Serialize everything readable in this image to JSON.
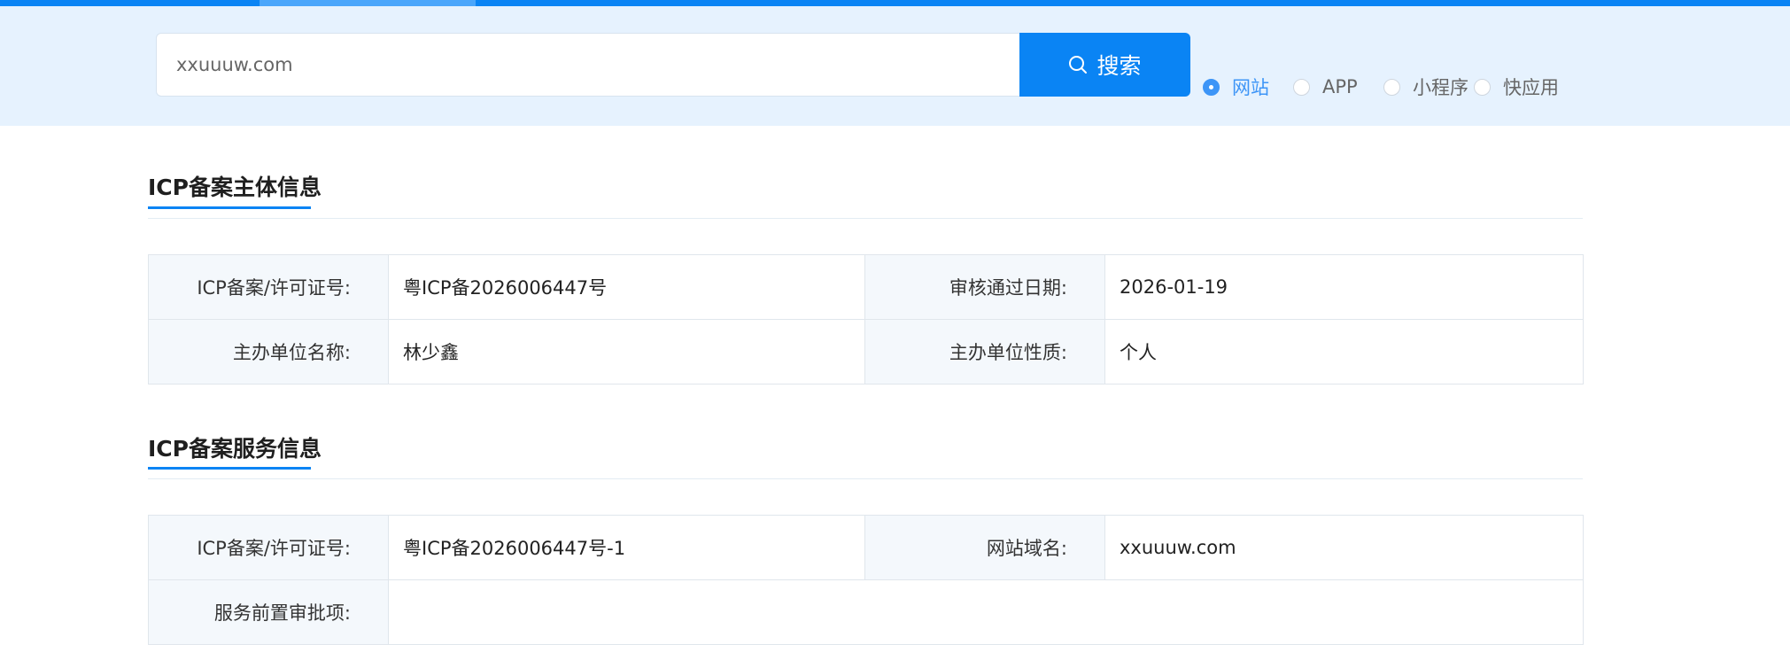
{
  "search": {
    "value": "xxuuuw.com",
    "button_label": "搜索",
    "button_icon": "search-icon",
    "accent_color": "#0a84f4"
  },
  "radio_options": [
    {
      "label": "网站",
      "selected": true
    },
    {
      "label": "APP",
      "selected": false
    },
    {
      "label": "小程序",
      "selected": false
    },
    {
      "label": "快应用",
      "selected": false
    }
  ],
  "subject_section": {
    "title": "ICP备案主体信息",
    "rows": [
      {
        "label1": "ICP备案/许可证号:",
        "value1": "粤ICP备2026006447号",
        "label2": "审核通过日期:",
        "value2": "2026-01-19"
      },
      {
        "label1": "主办单位名称:",
        "value1": "林少鑫",
        "label2": "主办单位性质:",
        "value2": "个人"
      }
    ]
  },
  "service_section": {
    "title": "ICP备案服务信息",
    "rows": [
      {
        "label1": "ICP备案/许可证号:",
        "value1": "粤ICP备2026006447号-1",
        "label2": "网站域名:",
        "value2": "xxuuuw.com"
      },
      {
        "label1": "服务前置审批项:",
        "value1": ""
      }
    ]
  }
}
